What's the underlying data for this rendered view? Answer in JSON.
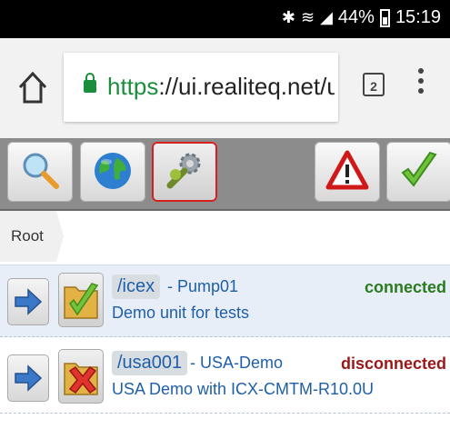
{
  "status_bar": {
    "icons": [
      "bluetooth-icon",
      "wifi-icon",
      "signal-icon"
    ],
    "battery": "44%",
    "battery_level": 0.44,
    "time": "15:19"
  },
  "browser": {
    "url_scheme": "https",
    "url_rest": "://ui.realiteq.net/ui/",
    "tab_count": "2"
  },
  "toolbar": {
    "buttons": [
      "search-icon",
      "globe-icon",
      "wrench-gear-icon",
      "warning-icon",
      "checkmark-icon"
    ],
    "selected": "wrench-gear-icon"
  },
  "breadcrumb": {
    "root": "Root"
  },
  "devices": [
    {
      "path": "/icex",
      "name": "- Pump01",
      "description": "Demo unit for tests",
      "status": "connected",
      "status_color": "#2a7a1e"
    },
    {
      "path": "/usa001",
      "name": "- USA-Demo",
      "description": "USA Demo with ICX-CMTM-R10.0U",
      "status": "disconnected",
      "status_color": "#9b1717"
    }
  ]
}
